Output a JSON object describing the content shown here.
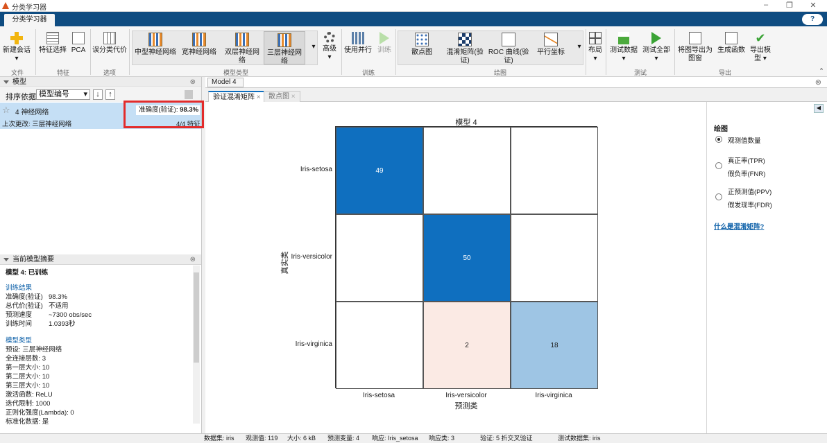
{
  "window": {
    "title": "分类学习器",
    "app_tab": "分类学习器",
    "help": "?"
  },
  "ribbon": {
    "file": {
      "new_session": "新建会话",
      "group": "文件"
    },
    "features": {
      "feature_selection": "特征选择",
      "pca": "PCA",
      "group": "特征"
    },
    "options": {
      "misclass_cost": "误分类代价",
      "group": "选项"
    },
    "model_type": {
      "items": [
        "中型神经网络",
        "宽神经网络",
        "双层神经网络",
        "三层神经网络"
      ],
      "advanced": "高级",
      "group": "模型类型"
    },
    "train": {
      "use_parallel": "使用并行",
      "train": "训练",
      "group": "训练"
    },
    "plots": {
      "items": [
        "散点图",
        "混淆矩阵(验证)",
        "ROC 曲线(验证)",
        "平行坐标"
      ],
      "group": "绘图"
    },
    "layout": {
      "label": "布局"
    },
    "test": {
      "test_data": "测试数据",
      "test_all": "测试全部",
      "group": "测试"
    },
    "export": {
      "export_plot": "将图导出为图窗",
      "gen_function": "生成函数",
      "export_model": "导出模型",
      "group": "导出"
    }
  },
  "models_pane": {
    "header": "模型",
    "sort_label": "排序依据:",
    "sort_value": "模型编号",
    "item": {
      "name": "4 神经网络",
      "accuracy_label": "准确度(验证):",
      "accuracy_value": "98.3%",
      "last_change": "上次更改: 三层神经网络",
      "features": "4/4 特征"
    }
  },
  "summary_pane": {
    "header": "当前模型摘要",
    "model_status": "模型 4: 已训练",
    "training_results": "训练结果",
    "results": [
      [
        "准确度(验证)",
        "98.3%"
      ],
      [
        "总代价(验证)",
        "不适用"
      ],
      [
        "预测速度",
        "~7300 obs/sec"
      ],
      [
        "训练时间",
        "1.0393秒"
      ]
    ],
    "model_type_title": "模型类型",
    "details": [
      "预设: 三层神经网络",
      "全连接层数: 3",
      "第一层大小: 10",
      "第二层大小: 10",
      "第三层大小: 10",
      "激活函数: ReLU",
      "迭代限制: 1000",
      "正则化强度(Lambda): 0",
      "标准化数据: 是"
    ]
  },
  "doc": {
    "model_tab": "Model 4",
    "tab_confusion": "验证混淆矩阵",
    "tab_scatter": "散点图"
  },
  "chart_data": {
    "type": "heatmap",
    "title": "模型 4",
    "xlabel": "预测类",
    "ylabel": "真实类",
    "categories": [
      "Iris-setosa",
      "Iris-versicolor",
      "Iris-virginica"
    ],
    "matrix": [
      [
        49,
        0,
        0
      ],
      [
        0,
        50,
        0
      ],
      [
        0,
        2,
        18
      ]
    ]
  },
  "plot_options": {
    "title": "绘图",
    "options": [
      "观测值数量",
      "真正率(TPR)",
      "假负率(FNR)",
      "正预测值(PPV)",
      "假发现率(FDR)"
    ],
    "link": "什么是混淆矩阵?"
  },
  "status": {
    "dataset": "数据集: iris",
    "obs": "观测值: 119",
    "size": "大小: 6 kB",
    "predictors": "预测变量: 4",
    "response": "响应: Iris_setosa",
    "classes": "响应类: 3",
    "validation": "验证: 5 折交叉验证",
    "testset": "测试数据集: iris"
  },
  "colors": {
    "dark_blue": "#0f6fbf",
    "light_blue": "#9ec5e4",
    "light_orange": "#fbeae4",
    "header_blue": "#0f4c81",
    "highlight": "#e32b2b"
  }
}
